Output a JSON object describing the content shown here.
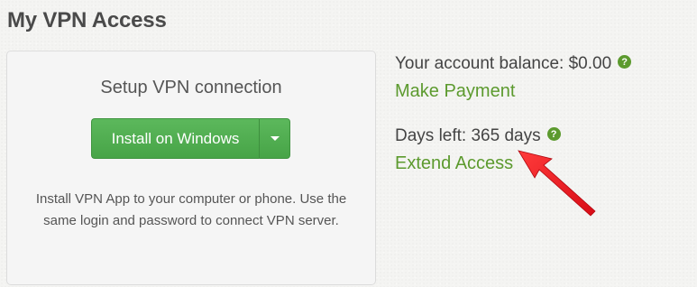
{
  "page": {
    "title": "My VPN Access"
  },
  "setup_panel": {
    "heading": "Setup VPN connection",
    "install_button_label": "Install on Windows",
    "description": "Install VPN App to your computer or phone. Use the same login and password to connect VPN server."
  },
  "account": {
    "balance_text": "Your account balance: $0.00",
    "make_payment_label": "Make Payment",
    "days_left_text": "Days left: 365 days",
    "extend_access_label": "Extend Access",
    "help_glyph": "?"
  },
  "colors": {
    "accent_green": "#5c9a2e",
    "button_green": "#5cb85c",
    "annotation_red": "#e8101c"
  },
  "icons": {
    "help": "question-circle-icon",
    "dropdown": "caret-down-icon",
    "annotation": "red-arrow-icon"
  }
}
